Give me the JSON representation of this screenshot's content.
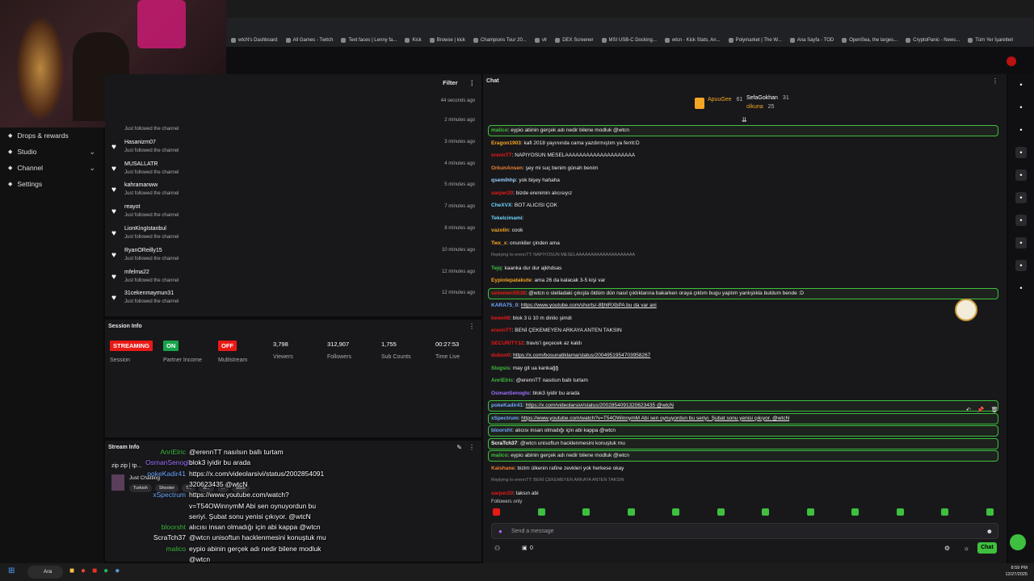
{
  "browser": {
    "bookmarks": [
      "wtcN's Dashboard",
      "All Games - Twitch",
      "Text faces | Lenny fa...",
      "Kick",
      "Browse | kick",
      "Champions Tour 20...",
      "vlr",
      "DEX Screener",
      "MSI USB-C Docking...",
      "wtcn - Kick Stats, An...",
      "Polymarket | The W...",
      "Ana Sayfa - TOD",
      "OpenSea, the larges...",
      "CryptoPanic - News...",
      "Tüm Yer İşaretleri"
    ]
  },
  "sidebar": {
    "items": [
      {
        "label": "Drops & rewards",
        "icon": "gift-icon"
      },
      {
        "label": "Studio",
        "icon": "studio-icon"
      },
      {
        "label": "Channel",
        "icon": "channel-icon"
      },
      {
        "label": "Settings",
        "icon": "gear-icon"
      }
    ]
  },
  "activity": {
    "filter_label": "Filter",
    "first_time": "44 seconds ago",
    "followed_text": "Just followed the channel",
    "rows": [
      {
        "name": "",
        "time": "2 minutes ago"
      },
      {
        "name": "Hasanizm07",
        "time": "3 minutes ago"
      },
      {
        "name": "MUSALLATR",
        "time": "4 minutes ago"
      },
      {
        "name": "kahramanww",
        "time": "5 minutes ago"
      },
      {
        "name": "reayot",
        "time": "7 minutes ago"
      },
      {
        "name": "LionKingIstanbul",
        "time": "8 minutes ago"
      },
      {
        "name": "RyanOReilly15",
        "time": "10 minutes ago"
      },
      {
        "name": "mfelma22",
        "time": "12 minutes ago"
      },
      {
        "name": "31cekenmaymun31",
        "time": "12 minutes ago"
      }
    ]
  },
  "session": {
    "title": "Session Info",
    "stats": [
      {
        "value": "STREAMING",
        "label": "Session",
        "badge": true,
        "color": "#e91916"
      },
      {
        "value": "ON",
        "label": "Partner Income",
        "badge": true,
        "color": "#16a34a"
      },
      {
        "value": "OFF",
        "label": "Multistream",
        "badge": true,
        "color": "#e91916"
      },
      {
        "value": "3,798",
        "label": "Viewers"
      },
      {
        "value": "312,907",
        "label": "Followers"
      },
      {
        "value": "1,755",
        "label": "Sub Counts"
      },
      {
        "value": "00:27:53",
        "label": "Time Live"
      }
    ]
  },
  "streaminfo": {
    "title": "Stream Info",
    "stream_title": "zip zip | tp...",
    "category": "Just Chatting",
    "tags": [
      "Turkish",
      "Shooter",
      "T...",
      "w...",
      "...",
      "wtcn"
    ]
  },
  "chat": {
    "title": "Chat",
    "leaders": [
      {
        "name": "ApuuGee",
        "score": "61"
      },
      {
        "name": "SefaGokhan",
        "score": "31"
      },
      {
        "name": "olkuna",
        "score": "25"
      }
    ],
    "messages": [
      {
        "u": "malico",
        "c": "#3fbf3f",
        "t": "eypio abinin gerçek adı nedir bilene modluk @wtcn",
        "hl": true
      },
      {
        "u": "Eragon1903",
        "c": "#f5a623",
        "t": "kafi 2018 yayınında cama yazdırmıştım ya ferrit:D"
      },
      {
        "u": "erennTT",
        "c": "#e91916",
        "t": "NAPIYOSUN MESELAAAAAAAAAAAAAAAAAAAA"
      },
      {
        "u": "OrkunAnsen",
        "c": "#f08030",
        "t": "şey mi suç benim günah benim"
      },
      {
        "u": "qsemihhp",
        "c": "#9ad0ff",
        "t": "yok bişey hahaha"
      },
      {
        "u": "sarper20",
        "c": "#e91916",
        "t": "bizde erenimin alıcısıyız"
      },
      {
        "u": "CheXVX",
        "c": "#6fd6ff",
        "t": "BOT ALICISI ÇOK"
      },
      {
        "u": "Tekelcimami",
        "c": "#6fd6ff",
        "t": ""
      },
      {
        "u": "vazolin",
        "c": "#f5a623",
        "t": "cook"
      },
      {
        "u": "Twx_x",
        "c": "#f5a623",
        "t": "onunkiler çinden ama"
      },
      {
        "u": "",
        "c": "#888",
        "t": "Replying to erennTT: NAPIYOSUN MESELAAAAAAAAAAAAAAAAAAAA"
      },
      {
        "u": "Tejq",
        "c": "#3fbf3f",
        "t": "kaanka dur dur ajkhdsas"
      },
      {
        "u": "Eypiolepatakute",
        "c": "#f5a623",
        "t": "ama 26 da kalacak 3-5 kişi var"
      },
      {
        "u": "seliemeri0538",
        "c": "#e91916",
        "t": "@wtcn o stelladaki çıkışta öldüm dün nasıl çıktıklarına bakarken oraya çıktım bugu yaptım yanlışlıkla buldum bende :D",
        "hl": true
      },
      {
        "u": "KARA75_0",
        "c": "#6fa8ff",
        "t": "https://www.youtube.com/shorts/-8fjhtRXbPA bu da var ani"
      },
      {
        "u": "kewell8",
        "c": "#e91916",
        "t": "blok 3 ü 10 m dinlio şimdi"
      },
      {
        "u": "erennTT",
        "c": "#e91916",
        "t": "BENİ ÇEKEMEYEN ARKAYA ANTEN TAKSIN"
      },
      {
        "u": "SECURITY32",
        "c": "#e91916",
        "t": "travis'i geçecek az kaldı"
      },
      {
        "u": "dubon0",
        "c": "#e91916",
        "t": "https://x.com/bosunatiklama/status/2004951954703958267"
      },
      {
        "u": "Slugsis",
        "c": "#3fbf3f",
        "t": "may git ua kankağğ"
      },
      {
        "u": "AnriElric",
        "c": "#3fbf3f",
        "t": "@erennTT nasılsın ballı turtam"
      },
      {
        "u": "OsmanSenoglu",
        "c": "#a070ff",
        "t": "blok3 iyidir bu arada"
      },
      {
        "u": "pokeKadir41",
        "c": "#6fa8ff",
        "t": "https://x.com/videolarsivi/status/2002854091320623435 @wtcN",
        "hl": true
      },
      {
        "u": "xSpectrum",
        "c": "#6fa8ff",
        "t": "https://www.youtube.com/watch?v=T54OWinnymM Abi sen oynuyordun bu seriyi. Şubat sonu yenisi çıkıyor. @wtcN",
        "hl": true
      },
      {
        "u": "bloorsht",
        "c": "#6fa8ff",
        "t": "alıcısı insan olmadığı için abi kappa @wtcn",
        "hl": true
      },
      {
        "u": "ScraTch37",
        "c": "#fff",
        "t": "@wtcn unisoftun hacklenmesini konuştuk mu",
        "hl": true
      },
      {
        "u": "malico",
        "c": "#3fbf3f",
        "t": "eypio abinin gerçek adı nedir bilene modluk @wtcn",
        "hl": true
      },
      {
        "u": "Kaishane",
        "c": "#f08030",
        "t": "bizim ülkenin rafine zevkleri yok herkese okay"
      },
      {
        "u": "",
        "c": "#888",
        "t": "Replying to erennTT: BENİ ÇEKEMEYEN ARKAYA ANTEN TAKSIN"
      },
      {
        "u": "sarper20",
        "c": "#e91916",
        "t": "taksın abi"
      }
    ],
    "followers_only": "Followers only",
    "input_placeholder": "Send a message",
    "send_label": "Chat",
    "counter": "0"
  },
  "overlay": [
    {
      "u": "AnriElric",
      "c": "#3fbf3f",
      "t": "@erennTT nasılsın ballı turtam"
    },
    {
      "u": "OsmanSenoglu",
      "c": "#a070ff",
      "t": "blok3 iyidir bu arada"
    },
    {
      "u": "pokeKadir41",
      "c": "#6fa8ff",
      "t": "https://x.com/videolarsivi/status/2002854091"
    },
    {
      "u": "",
      "c": "#fff",
      "t": "320623435 @wtcN"
    },
    {
      "u": "xSpectrum",
      "c": "#6fa8ff",
      "t": "https://www.youtube.com/watch?"
    },
    {
      "u": "",
      "c": "#fff",
      "t": "v=T54OWinnymM Abi sen oynuyordun bu"
    },
    {
      "u": "",
      "c": "#fff",
      "t": "seriyi. Şubat sonu yenisi çıkıyor. @wtcN"
    },
    {
      "u": "bloorsht",
      "c": "#3fbf3f",
      "t": "alıcısı insan olmadığı için abi kappa @wtcn"
    },
    {
      "u": "ScraTch37",
      "c": "#fff",
      "t": "@wtcn unisoftun hacklenmesini konuştuk mu"
    },
    {
      "u": "malico",
      "c": "#3fbf3f",
      "t": "eypio abinin gerçek adı nedir bilene modluk"
    },
    {
      "u": "",
      "c": "#fff",
      "t": "@wtcn"
    },
    {
      "u": "Kaishane",
      "c": "#f5a623",
      "t": "bizim ülkenin rafine zevkleri yok herkese okay"
    }
  ],
  "taskbar": {
    "search": "Ara",
    "time": "8:59 PM",
    "date": "12/27/2025"
  }
}
